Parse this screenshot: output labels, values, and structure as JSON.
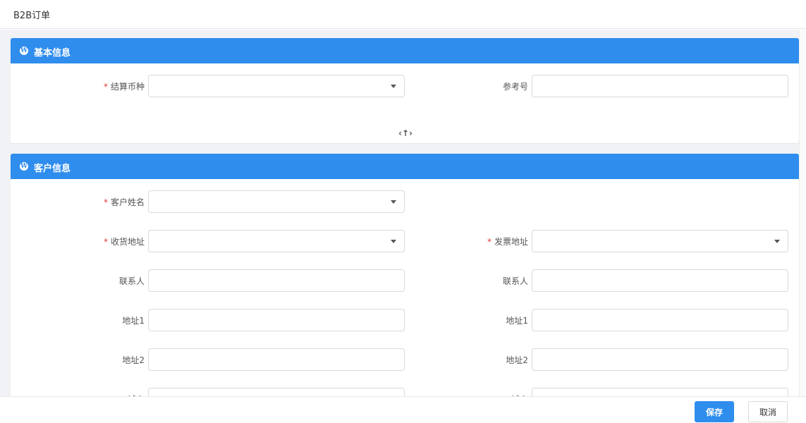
{
  "page": {
    "title": "B2B订单"
  },
  "basic_info": {
    "header": "基本信息",
    "icon": "wordpress-icon",
    "fields": {
      "currency": {
        "label": "结算币种",
        "value": "",
        "required": true
      },
      "reference": {
        "label": "参考号",
        "value": ""
      }
    },
    "collapse_icon": "‹↑›"
  },
  "customer_info": {
    "header": "客户信息",
    "icon": "wordpress-icon",
    "fields": {
      "customer_name": {
        "label": "客户姓名",
        "value": "",
        "required": true
      },
      "shipping_address": {
        "label": "收货地址",
        "value": "",
        "required": true
      },
      "billing_address": {
        "label": "发票地址",
        "value": "",
        "required": true
      },
      "contact_left": {
        "label": "联系人",
        "value": ""
      },
      "contact_right": {
        "label": "联系人",
        "value": ""
      },
      "address1_left": {
        "label": "地址1",
        "value": ""
      },
      "address1_right": {
        "label": "地址1",
        "value": ""
      },
      "address2_left": {
        "label": "地址2",
        "value": ""
      },
      "address2_right": {
        "label": "地址2",
        "value": ""
      },
      "city_left": {
        "label": "城市",
        "value": ""
      },
      "city_right": {
        "label": "城市",
        "value": ""
      }
    }
  },
  "footer": {
    "save_label": "保存",
    "cancel_label": "取消"
  },
  "required_mark": "*",
  "colors": {
    "accent": "#2e8ded",
    "required": "#e4393c",
    "border": "#d9d9d9"
  }
}
